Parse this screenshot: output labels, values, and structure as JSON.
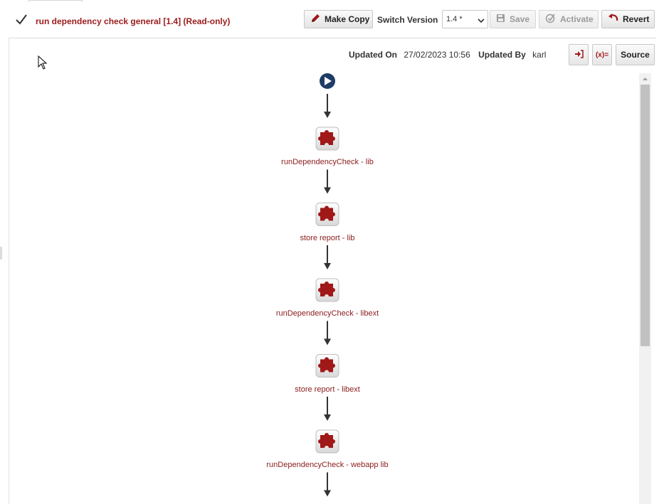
{
  "header": {
    "title": "run dependency check general [1.4] (Read-only)",
    "make_copy_label": "Make Copy",
    "switch_version_label": "Switch Version",
    "version_selected": "1.4 *",
    "save_label": "Save",
    "activate_label": "Activate",
    "revert_label": "Revert"
  },
  "meta": {
    "updated_on_label": "Updated On",
    "updated_on_value": "27/02/2023 10:56",
    "updated_by_label": "Updated By",
    "updated_by_value": "karl"
  },
  "toolbar": {
    "variables_label": "(x)=",
    "source_label": "Source"
  },
  "flow": {
    "steps": [
      {
        "label": "runDependencyCheck - lib"
      },
      {
        "label": "store report - lib"
      },
      {
        "label": "runDependencyCheck - libext"
      },
      {
        "label": "store report - libext"
      },
      {
        "label": "runDependencyCheck - webapp lib"
      }
    ]
  },
  "colors": {
    "title_red": "#9b1c1c",
    "puzzle_red": "#a01818",
    "start_blue": "#1e3d66"
  },
  "icons": [
    "check-icon",
    "pencil-icon",
    "floppy-icon",
    "activate-icon",
    "undo-icon",
    "import-icon",
    "play-icon",
    "puzzle-icon",
    "chevron-down-icon"
  ]
}
